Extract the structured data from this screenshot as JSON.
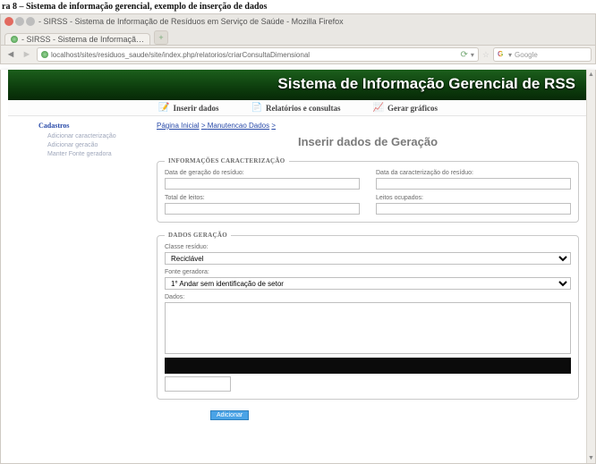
{
  "caption": "ra 8 – Sistema de informação gerencial, exemplo de inserção de dados",
  "window": {
    "title": " - SIRSS - Sistema de Informação de Resíduos em Serviço de Saúde - Mozilla Firefox",
    "tab_label": " - SIRSS - Sistema de Informaçã…",
    "url": "localhost/sites/residuos_saude/site/index.php/relatorios/criarConsultaDimensional",
    "search_placeholder": "Google"
  },
  "header": {
    "title": "Sistema de Informação Gerencial de RSS"
  },
  "menu": {
    "items": [
      {
        "label": "Inserir dados",
        "icon": "📝"
      },
      {
        "label": "Relatórios e consultas",
        "icon": "📄"
      },
      {
        "label": "Gerar gráficos",
        "icon": "📈"
      }
    ]
  },
  "sidebar": {
    "title": "Cadastros",
    "links": [
      {
        "label": "Adicionar caracterização"
      },
      {
        "label": "Adicionar geracão"
      },
      {
        "label": "Manter Fonte geradora"
      }
    ]
  },
  "breadcrumb": {
    "items": [
      "Página Inicial",
      "Manutencao Dados"
    ],
    "sep": " > "
  },
  "page_title": "Inserir dados de Geração",
  "fieldsets": {
    "info": {
      "legend": "INFORMAÇÕES CARACTERIZAÇÃO",
      "fields": {
        "data_geracao": {
          "label": "Data de geração do resíduo:",
          "value": ""
        },
        "data_caract": {
          "label": "Data da caracterização do resíduo:",
          "value": ""
        },
        "total_leitos": {
          "label": "Total de leitos:",
          "value": ""
        },
        "leitos_ocup": {
          "label": "Leitos ocupados:",
          "value": ""
        }
      }
    },
    "dados": {
      "legend": "DADOS GERAÇÃO",
      "fields": {
        "classe": {
          "label": "Classe resíduo:",
          "value": "Reciclável"
        },
        "fonte": {
          "label": "Fonte geradora:",
          "value": "1° Andar sem identificação de setor"
        },
        "dados": {
          "label": "Dados:"
        }
      }
    }
  },
  "submit_label": "Adicionar"
}
